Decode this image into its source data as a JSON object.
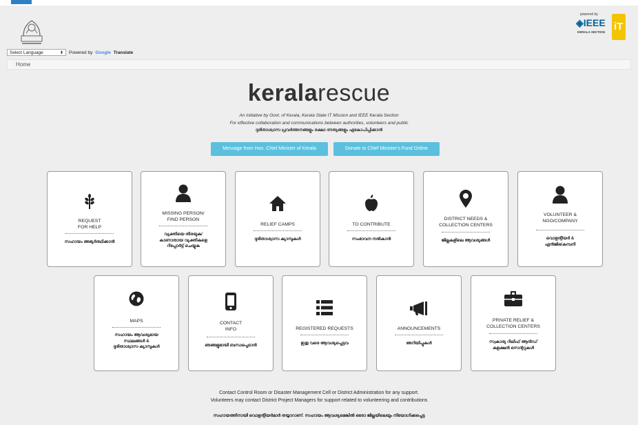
{
  "header": {
    "powered_by": "powered by",
    "ieee_label": "◈IEEE",
    "kerala_section": "KERALA SECTION",
    "it_mission": "iT"
  },
  "lang": {
    "select_label": "Select Language",
    "powered_by": "Powered by",
    "google": "Google",
    "translate": "Translate"
  },
  "breadcrumb": {
    "home": "Home"
  },
  "brand": {
    "bold": "kerala",
    "light": "rescue"
  },
  "tagline": {
    "line1": "An initiative by Govt. of Kerala, Kerala State IT Mission and IEEE Kerala Section",
    "line2": "For effective collaboration and communications between authorities, volunteers and public",
    "line3": "ദുരിതാശ്വാസ പ്രവർത്തനങ്ങളും രക്ഷാ ദൗത്യങ്ങളും ഏകോപിപ്പിക്കാൻ"
  },
  "cta": {
    "cm_message": "Message from Hon. Chief Minister of Kerala",
    "donate": "Donate to Chief Minister's Fund Online"
  },
  "cards_row1": [
    {
      "title1": "REQUEST",
      "title2": "FOR HELP",
      "sub1": "സഹായം അഭ്യർത്ഥിക്കാൻ",
      "sub2": "",
      "sub3": "",
      "icon": "wheat-icon"
    },
    {
      "title1": "MISSING PERSON/",
      "title2": "FIND PERSON",
      "sub1": "വ്യക്തിയെ തിരയുക/",
      "sub2": "കാണാതായ വ്യക്തികളെ",
      "sub3": "റിപ്പോർട്ട് ചെയ്യുക",
      "icon": "user-icon"
    },
    {
      "title1": "RELIEF CAMPS",
      "title2": "",
      "sub1": "ദുരിതാശ്വാസ ക്യാമ്പുകൾ",
      "sub2": "",
      "sub3": "",
      "icon": "home-icon"
    },
    {
      "title1": "TO CONTRIBUTE",
      "title2": "",
      "sub1": "സംഭാവന നൽകാൻ",
      "sub2": "",
      "sub3": "",
      "icon": "apple-icon"
    },
    {
      "title1": "DISTRICT NEEDS &",
      "title2": "COLLECTION CENTERS",
      "sub1": "ജില്ലകളിലെ ആവശ്യങ്ങൾ",
      "sub2": "",
      "sub3": "",
      "icon": "map-marker-icon"
    },
    {
      "title1": "VOLUNTEER &",
      "title2": "NGO/COMPANY",
      "sub1": "വൊളന്റിയർ &",
      "sub2": "എൻജിഒ/കമ്പനി",
      "sub3": "",
      "icon": "volunteer-icon"
    }
  ],
  "cards_row2": [
    {
      "title1": "MAPS",
      "title2": "",
      "sub1": "സഹായം ആവശ്യമായ",
      "sub2": "സ്ഥലങ്ങൾ &",
      "sub3": "ദുരിതാശ്വാസ ക്യാമ്പുകൾ",
      "icon": "globe-icon"
    },
    {
      "title1": "CONTACT",
      "title2": "INFO",
      "sub1": "ഞങ്ങളുമായി ബന്ധപ്പെടാൻ",
      "sub2": "",
      "sub3": "",
      "icon": "phone-icon"
    },
    {
      "title1": "REGISTERED REQUESTS",
      "title2": "",
      "sub1": "ഇതു വരെ ആവശ്യപ്പെട്ടവ",
      "sub2": "",
      "sub3": "",
      "icon": "list-icon"
    },
    {
      "title1": "ANNOUNCEMENTS",
      "title2": "",
      "sub1": "അറിയിപ്പുകൾ",
      "sub2": "",
      "sub3": "",
      "icon": "bullhorn-icon"
    },
    {
      "title1": "PRIVATE RELIEF &",
      "title2": "COLLECTION CENTERS",
      "sub1": "സ്വകാര്യ റിലീഫ് ആൻഡ്",
      "sub2": "കളക്ഷൻ സെന്ററുകൾ",
      "sub3": "",
      "icon": "briefcase-icon"
    }
  ],
  "footer": {
    "line1": "Contact Control Room or Disaster Management Cell or District Administration for any support.",
    "line2": "Volunteers may contact District Project Managers for support related to volunteering and contributions",
    "line3": "സഹായത്തിനായി വൊളന്റിയർമാർ തയ്യാറാണ്. സഹായം ആവശ്യമെങ്കിൽ ഒരോ ജില്ലയിലെയും നിയോഗിക്കപ്പെട്ട"
  }
}
